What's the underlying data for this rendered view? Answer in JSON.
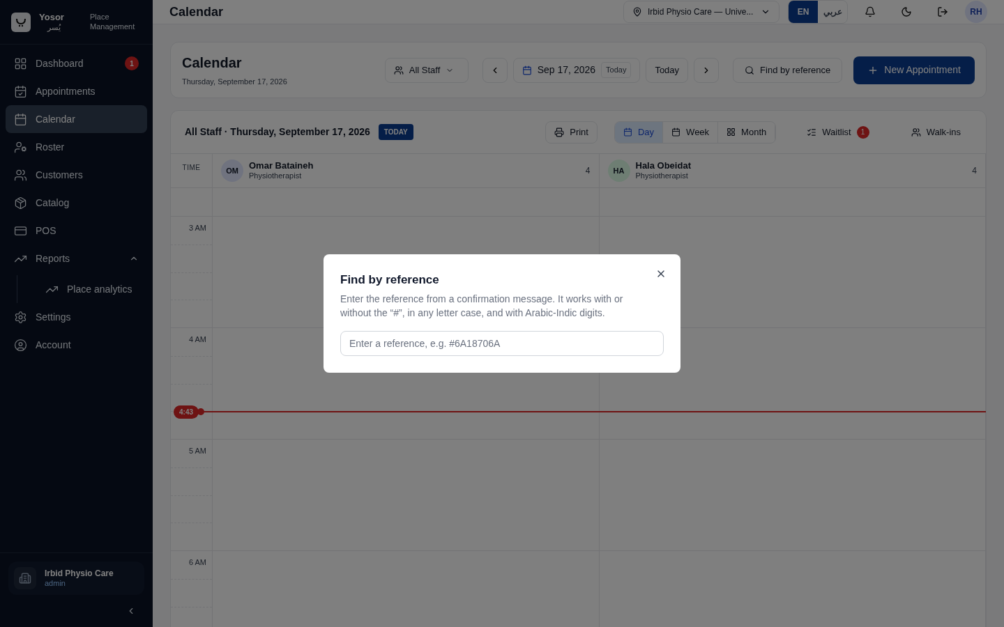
{
  "sidebar": {
    "brand": "Yosor",
    "brand_sub": "يُسر",
    "product": "Place Management",
    "items": [
      {
        "label": "Dashboard",
        "selected": false,
        "badge": "1"
      },
      {
        "label": "Appointments",
        "selected": false
      },
      {
        "label": "Calendar",
        "selected": true
      },
      {
        "label": "Roster",
        "selected": false
      },
      {
        "label": "Customers",
        "selected": false
      },
      {
        "label": "Catalog",
        "selected": false
      },
      {
        "label": "POS",
        "selected": false
      },
      {
        "label": "Reports",
        "selected": false,
        "expanded": true,
        "children": [
          {
            "label": "Place analytics",
            "selected": false
          }
        ]
      },
      {
        "label": "Settings",
        "selected": false
      },
      {
        "label": "Account",
        "selected": false
      }
    ],
    "place": {
      "name": "Irbid Physio Care",
      "role": "admin"
    }
  },
  "header": {
    "title": "Calendar",
    "location": "Irbid Physio Care — Unive...",
    "languages": [
      {
        "label": "EN",
        "selected": true
      },
      {
        "label": "عربي",
        "selected": false
      }
    ],
    "avatar": "RH"
  },
  "toolbar": {
    "title": "Calendar",
    "subtitle": "Thursday, September 17, 2026",
    "staff_filter": "All Staff",
    "date": "Sep 17, 2026",
    "date_badge": "Today",
    "today_button": "Today",
    "find_button": "Find by reference",
    "new_button": "New Appointment"
  },
  "calendar": {
    "heading": "All Staff · Thursday, September 17, 2026",
    "heading_badge": "TODAY",
    "print": "Print",
    "views": [
      {
        "label": "Day",
        "selected": true
      },
      {
        "label": "Week",
        "selected": false
      },
      {
        "label": "Month",
        "selected": false
      }
    ],
    "waitlist": {
      "label": "Waitlist",
      "count": "1"
    },
    "walkins": "Walk-ins",
    "time_header": "TIME",
    "staff": [
      {
        "initials": "OM",
        "name": "Omar Bataineh",
        "role": "Physiotherapist",
        "count": "4"
      },
      {
        "initials": "HA",
        "name": "Hala Obeidat",
        "role": "Physiotherapist",
        "count": "4"
      }
    ],
    "hours": [
      "3 AM",
      "4 AM",
      "5 AM",
      "6 AM"
    ],
    "now": "4:43"
  },
  "dialog": {
    "title": "Find by reference",
    "description": "Enter the reference from a confirmation message. It works with or without the “#”, in any letter case, and with Arabic-Indic digits.",
    "placeholder": "Enter a reference, e.g. #6A18706A"
  }
}
